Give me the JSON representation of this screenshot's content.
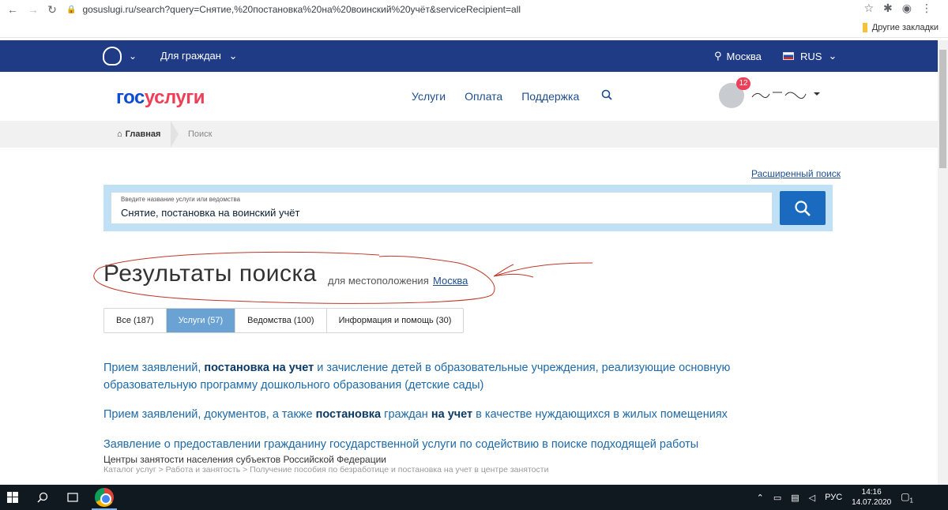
{
  "browser": {
    "url": "gosuslugi.ru/search?query=Снятие,%20постановка%20на%20воинский%20учёт&serviceRecipient=all",
    "bookmarks_other": "Другие закладки"
  },
  "topbar": {
    "audience": "Для граждан",
    "city": "Москва",
    "language": "RUS"
  },
  "header": {
    "logo_gos": "гос",
    "logo_uslugi": "услуги",
    "nav": [
      "Услуги",
      "Оплата",
      "Поддержка"
    ],
    "notifications_count": "12"
  },
  "breadcrumb": {
    "home": "Главная",
    "current": "Поиск"
  },
  "search": {
    "advanced_link": "Расширенный поиск",
    "placeholder": "Введите название услуги или ведомства",
    "value": "Снятие, постановка на воинский учёт"
  },
  "results": {
    "title": "Результаты поиска",
    "location_label": "для местоположения",
    "location": "Москва",
    "tabs": [
      {
        "label": "Все (187)",
        "active": false
      },
      {
        "label": "Услуги (57)",
        "active": true
      },
      {
        "label": "Ведомства (100)",
        "active": false
      },
      {
        "label": "Информация и помощь (30)",
        "active": false
      }
    ],
    "items": [
      {
        "parts": [
          {
            "text": "Прием заявлений, ",
            "bold": false
          },
          {
            "text": "постановка на учет",
            "bold": true
          },
          {
            "text": " и зачисление детей в образовательные учреждения, реализующие основную образовательную программу дошкольного образования (детские сады)",
            "bold": false
          }
        ]
      },
      {
        "parts": [
          {
            "text": "Прием заявлений, документов, а также ",
            "bold": false
          },
          {
            "text": "постановка",
            "bold": true
          },
          {
            "text": " граждан ",
            "bold": false
          },
          {
            "text": "на учет",
            "bold": true
          },
          {
            "text": " в качестве нуждающихся в жилых помещениях",
            "bold": false
          }
        ]
      },
      {
        "parts": [
          {
            "text": "Заявление о предоставлении гражданину государственной услуги по содействию в поиске подходящей работы",
            "bold": false
          }
        ],
        "department": "Центры занятости населения субъектов Российской Федерации",
        "path": "Каталог услуг > Работа и занятость > Получение пособия по безработице и постановка на учет в центре занятости"
      }
    ]
  },
  "taskbar": {
    "language": "РУС",
    "time": "14:16",
    "date": "14.07.2020",
    "notification_count": "1"
  }
}
